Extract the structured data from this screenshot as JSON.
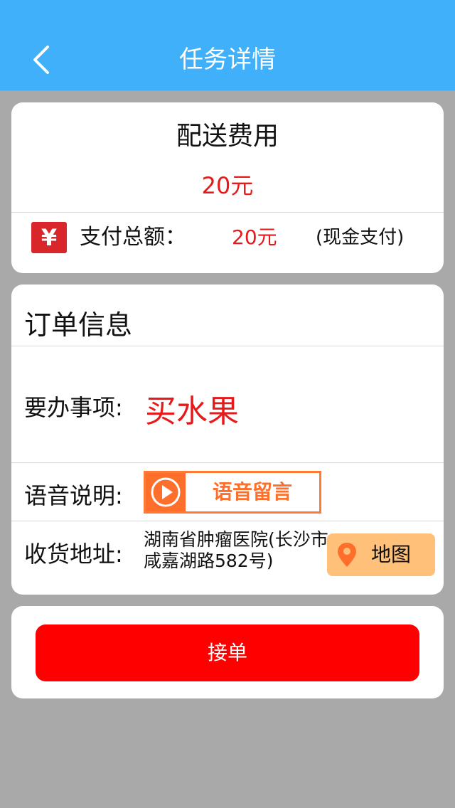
{
  "nav": {
    "title": "任务详情",
    "back_icon": "chevron-left-icon"
  },
  "fee": {
    "title": "配送费用",
    "amount": "20元",
    "yen_symbol": "¥",
    "total_label": "支付总额：",
    "total_amount": "20元",
    "payment_method": "(现金支付)"
  },
  "order": {
    "title": "订单信息",
    "todo_label": "要办事项:",
    "todo_value": "买水果",
    "voice_label": "语音说明:",
    "voice_button_label": "语音留言",
    "address_label": "收货地址:",
    "address_value": "湖南省肿瘤医院(长沙市咸嘉湖路582号)",
    "map_button_label": "地图"
  },
  "action": {
    "accept_label": "接单"
  },
  "colors": {
    "header_blue": "#3fb0f9",
    "price_red": "#e61a1a",
    "accept_red": "#ff0000",
    "voice_orange": "#ff6f2c",
    "map_button_bg": "#ffc07a"
  }
}
